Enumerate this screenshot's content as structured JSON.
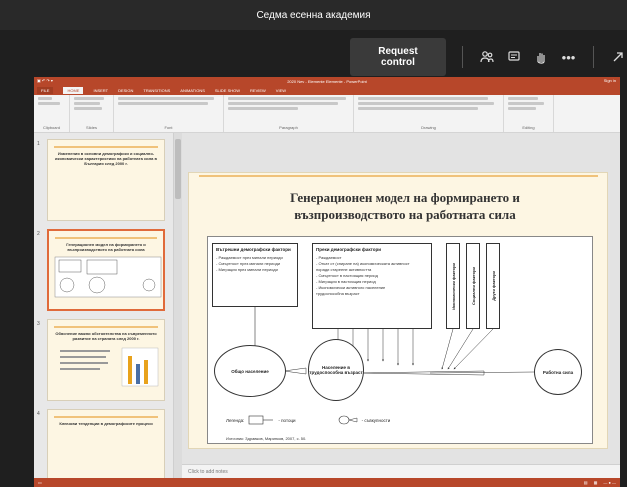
{
  "teams": {
    "title": "Седма есенна академия",
    "request_control": "Request control"
  },
  "ppt": {
    "title": "2020 Nev - Elemente Elemente - PowerPoint",
    "sign_in": "Sign in",
    "tabs": [
      "FILE",
      "HOME",
      "INSERT",
      "DESIGN",
      "TRANSITIONS",
      "ANIMATIONS",
      "SLIDE SHOW",
      "REVIEW",
      "VIEW"
    ],
    "groups": [
      "Clipboard",
      "Slides",
      "Font",
      "Paragraph",
      "Drawing",
      "Editing"
    ],
    "notes_placeholder": "Click to add notes"
  },
  "thumbnails": [
    {
      "num": "1",
      "title": "Изменения в основни демографски и социално-икономически характеристики на работната сила в България след 2000 г.",
      "body": ""
    },
    {
      "num": "2",
      "title": "Генерационен модел на формирането и възпроизводството на работната сила",
      "body": ""
    },
    {
      "num": "3",
      "title": "Обяснение важни обстоятелства на съвременното развитие на страната след 2000 г.",
      "body": ""
    },
    {
      "num": "4",
      "title": "Ключови тенденции в демографските процеси",
      "body": ""
    }
  ],
  "slide": {
    "title_line1": "Генерационен модел на формирането и",
    "title_line2": "възпроизводството на работната сила",
    "box1": {
      "heading": "Вътрешни демографски фактори",
      "items": [
        "- Раждаемост през минали периоди",
        "- Смъртност през минали периоди",
        "- Миграция през минали периоди"
      ]
    },
    "box2": {
      "heading": "Преки демографски фактори",
      "items": [
        "- Раждаемост",
        "- Откат от (спиране на) икономическата активност",
        "  поради стареене активността",
        "- Смъртност в настоящия период",
        "- Миграция в настоящия период",
        "- Икономически активного население",
        "  трудоспособна възраст"
      ]
    },
    "vbox1": "Икономически фактори",
    "vbox2": "Социални фактори",
    "vbox3": "Други фактори",
    "circle1": "Общо население",
    "circle2": "Население в трудоспособна възраст",
    "circle3": "Работна сила",
    "legend_label": "Легенда:",
    "legend_item1": "- потоци",
    "legend_item2": "- съвкупности",
    "source": "Източник: Здравков, Маринков, 2007, с. 50."
  }
}
